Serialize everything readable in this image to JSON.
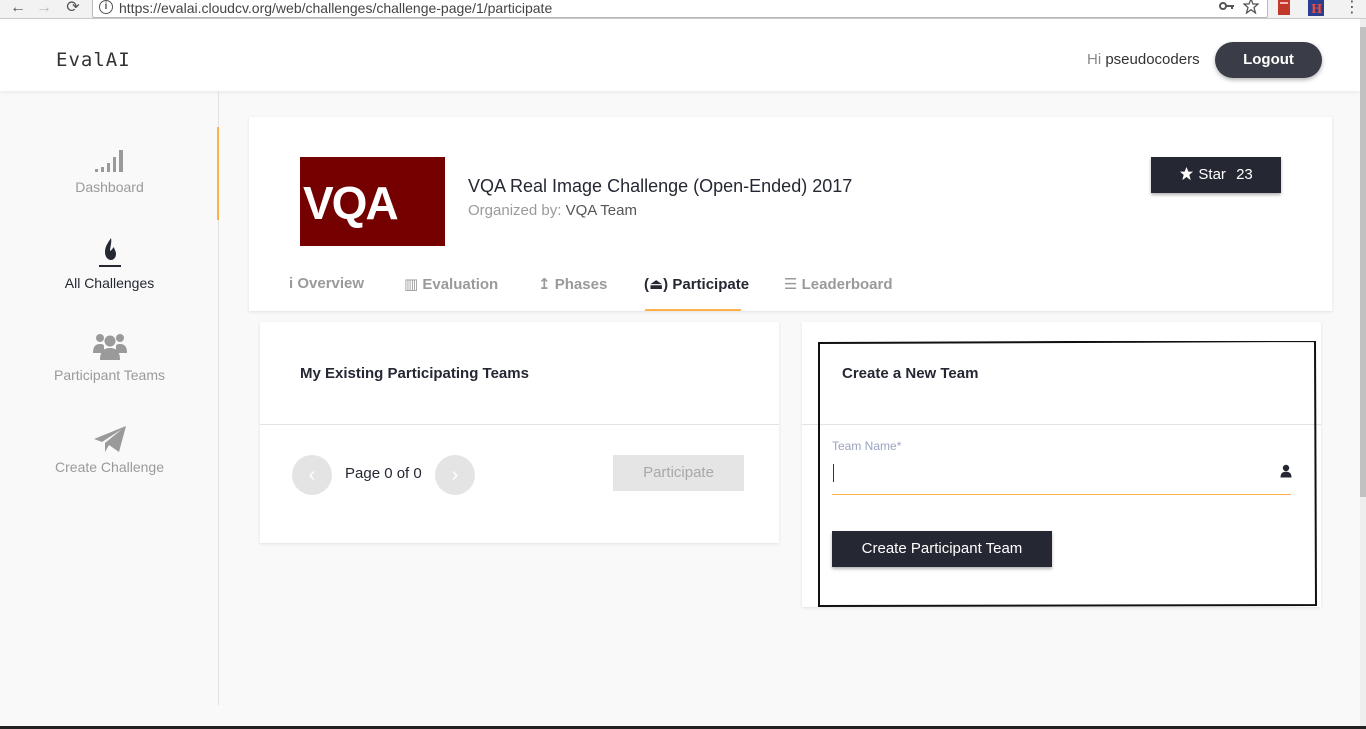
{
  "browser": {
    "back": "←",
    "forward": "→",
    "reload": "⟳",
    "info": "i",
    "url": "https://evalai.cloudcv.org/web/challenges/challenge-page/1/participate",
    "key_icon": "key-icon",
    "star_icon": "bookmark-star-icon",
    "menu": "⋮"
  },
  "header": {
    "logo": "EvalAI",
    "greeting_prefix": "Hi",
    "username": "pseudocoders",
    "logout_label": "Logout"
  },
  "sidebar": {
    "items": [
      {
        "label": "Dashboard",
        "icon": "signal-bars-icon"
      },
      {
        "label": "All Challenges",
        "icon": "flame-icon"
      },
      {
        "label": "Participant Teams",
        "icon": "users-icon"
      },
      {
        "label": "Create Challenge",
        "icon": "paper-plane-icon"
      }
    ],
    "accent_color": "#ffaf4b"
  },
  "challenge": {
    "logo_text": "VQA",
    "title": "VQA Real Image Challenge (Open-Ended) 2017",
    "organized_label": "Organized by:",
    "organizer": "VQA Team",
    "star_label": "Star",
    "star_count": "23",
    "tabs": [
      {
        "icon": "i",
        "label": "Overview"
      },
      {
        "icon": "▥",
        "label": "Evaluation"
      },
      {
        "icon": "↥",
        "label": "Phases"
      },
      {
        "icon": "(⏏)",
        "label": "Participate"
      },
      {
        "icon": "☰",
        "label": "Leaderboard"
      }
    ]
  },
  "existing_teams": {
    "title": "My Existing Participating Teams",
    "prev": "‹",
    "next": "›",
    "page_text": "Page 0 of 0",
    "participate_label": "Participate"
  },
  "create_team": {
    "title": "Create a New Team",
    "field_label": "Team Name*",
    "field_value": "",
    "button_label": "Create Participant Team"
  },
  "colors": {
    "primary_dark": "#252833",
    "accent": "#ffaf4b",
    "vqa_logo_bg": "#740000"
  }
}
